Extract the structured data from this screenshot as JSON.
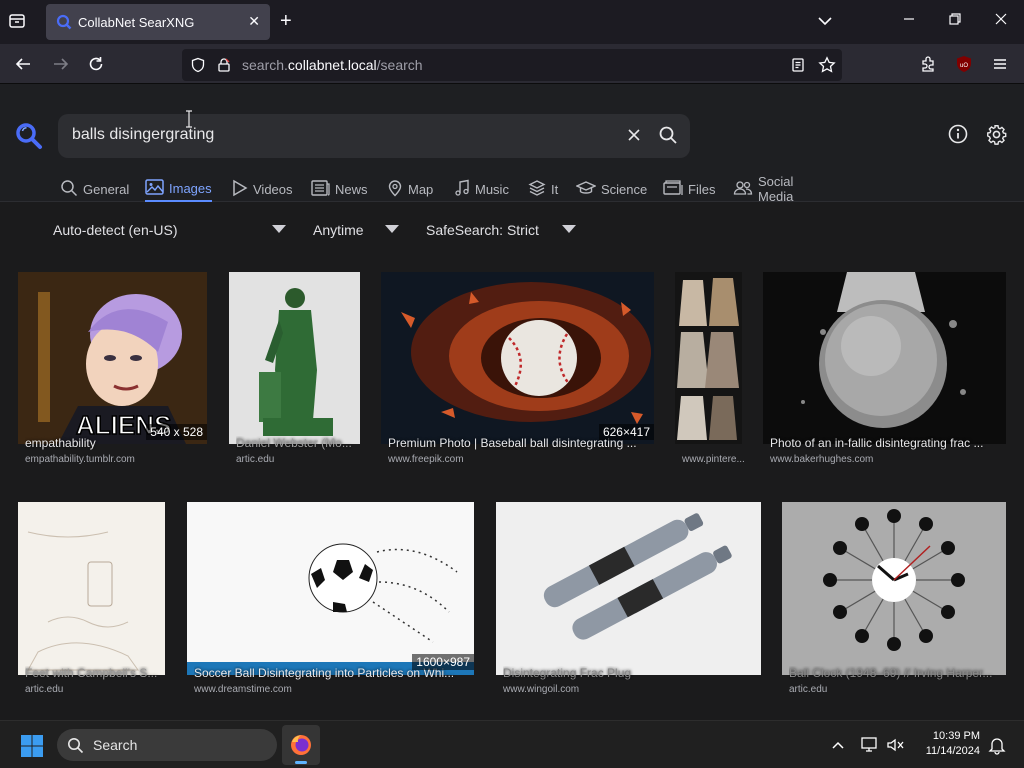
{
  "browser": {
    "tab_title": "CollabNet SearXNG",
    "url_host_prefix": "search.",
    "url_host_main": "collabnet.local",
    "url_path": "/search"
  },
  "search": {
    "query": "balls disingergrating"
  },
  "categories": [
    {
      "label": "General",
      "icon": "search-icon"
    },
    {
      "label": "Images",
      "icon": "image-icon"
    },
    {
      "label": "Videos",
      "icon": "play-icon"
    },
    {
      "label": "News",
      "icon": "newspaper-icon"
    },
    {
      "label": "Map",
      "icon": "map-pin-icon"
    },
    {
      "label": "Music",
      "icon": "music-icon"
    },
    {
      "label": "It",
      "icon": "layers-icon"
    },
    {
      "label": "Science",
      "icon": "school-icon"
    },
    {
      "label": "Files",
      "icon": "files-icon"
    },
    {
      "label": "Social Media",
      "icon": "people-icon"
    }
  ],
  "filters": {
    "language": "Auto-detect (en-US)",
    "time": "Anytime",
    "safesearch": "SafeSearch: Strict"
  },
  "results": [
    {
      "title": "empathability",
      "source": "empathability.tumblr.com",
      "resolution": "540 x 528"
    },
    {
      "title": "Daniel Webster (Mo...",
      "source": "artic.edu",
      "resolution": ""
    },
    {
      "title": "Premium Photo | Baseball ball disintegrating ...",
      "source": "www.freepik.com",
      "resolution": "626×417"
    },
    {
      "title": "",
      "source": "www.pintere...",
      "resolution": ""
    },
    {
      "title": "Photo of an in-fallic disintegrating frac ...",
      "source": "www.bakerhughes.com",
      "resolution": ""
    },
    {
      "title": "Feet with Campbell's S...",
      "source": "artic.edu",
      "resolution": ""
    },
    {
      "title": "Soccer Ball Disintegrating into Particles on Whi...",
      "source": "www.dreamstime.com",
      "resolution": "1600×987"
    },
    {
      "title": "Disintegrating Frac Plug",
      "source": "www.wingoil.com",
      "resolution": ""
    },
    {
      "title": "Ball Clock (1948–69) // Irving Harper...",
      "source": "artic.edu",
      "resolution": ""
    }
  ],
  "taskbar": {
    "search_label": "Search",
    "time": "10:39 PM",
    "date": "11/14/2024"
  },
  "colors": {
    "accent": "#5b8cff",
    "page_bg": "#1b1b1c",
    "chrome_bg": "#2b2a33"
  }
}
